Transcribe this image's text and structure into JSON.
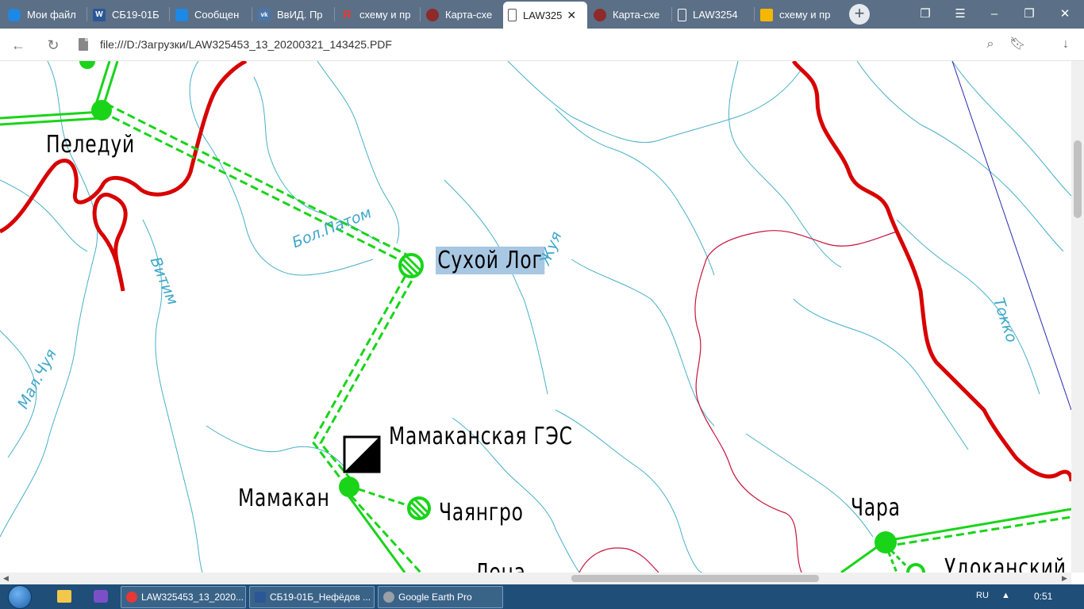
{
  "tabs": [
    {
      "label": "Мои файл",
      "icon": "onedrive-icon",
      "color": "#1e88e5"
    },
    {
      "label": "СБ19-01Б",
      "icon": "word-icon",
      "color": "#2b5797"
    },
    {
      "label": "Сообщен",
      "icon": "chat-bubble-icon",
      "color": "#1e88e5"
    },
    {
      "label": "ВвИД. Пр",
      "icon": "vk-icon",
      "color": "#4a76a8"
    },
    {
      "label": "схему и пр",
      "icon": "yandex-icon",
      "color": "#e53935"
    },
    {
      "label": "Карта-схе",
      "icon": "site-favicon-icon",
      "color": "#8e2a2a"
    },
    {
      "label": "LAW325",
      "icon": "document-icon",
      "color": "#ffffff",
      "active": true
    },
    {
      "label": "Карта-схе",
      "icon": "site-favicon-icon",
      "color": "#8e2a2a"
    },
    {
      "label": "LAW3254",
      "icon": "document-icon",
      "color": "#ffffff"
    },
    {
      "label": "схему и пр",
      "icon": "image-icon",
      "color": "#f6b700"
    }
  ],
  "address": {
    "url": "file:///D:/Загрузки/LAW325453_13_20200321_143425.PDF"
  },
  "map": {
    "cities": {
      "peleduy": "Пеледуй",
      "sukhoy_log": "Сухой Лог",
      "mamakanskaya": "Мамаканская ГЭС",
      "mamakan": "Мамакан",
      "chayangro": "Чаянгро",
      "chara": "Чара",
      "lena": "Лена",
      "udokansky": "Удоканский"
    },
    "rivers": {
      "bol_patom": "Бол.Патом",
      "vitim": "Витим",
      "mal_chuya": "Мал.Чуя",
      "zhuya": "Жуя",
      "tokko": "Токко"
    },
    "colors": {
      "line_green": "#19d419",
      "border_red": "#d80000",
      "river_blue": "#46b0c8",
      "boundary_crimson": "#c8143c"
    }
  },
  "taskbar": {
    "tasks": [
      {
        "label": "LAW325453_13_2020...",
        "icon": "yandex-browser-icon",
        "color": "#e53935"
      },
      {
        "label": "СБ19-01Б_Нефёдов ...",
        "icon": "word-icon",
        "color": "#2b5797"
      },
      {
        "label": "Google Earth Pro",
        "icon": "google-earth-icon",
        "color": "#9aa0a6"
      }
    ],
    "lang": "RU",
    "time": "0:51"
  }
}
